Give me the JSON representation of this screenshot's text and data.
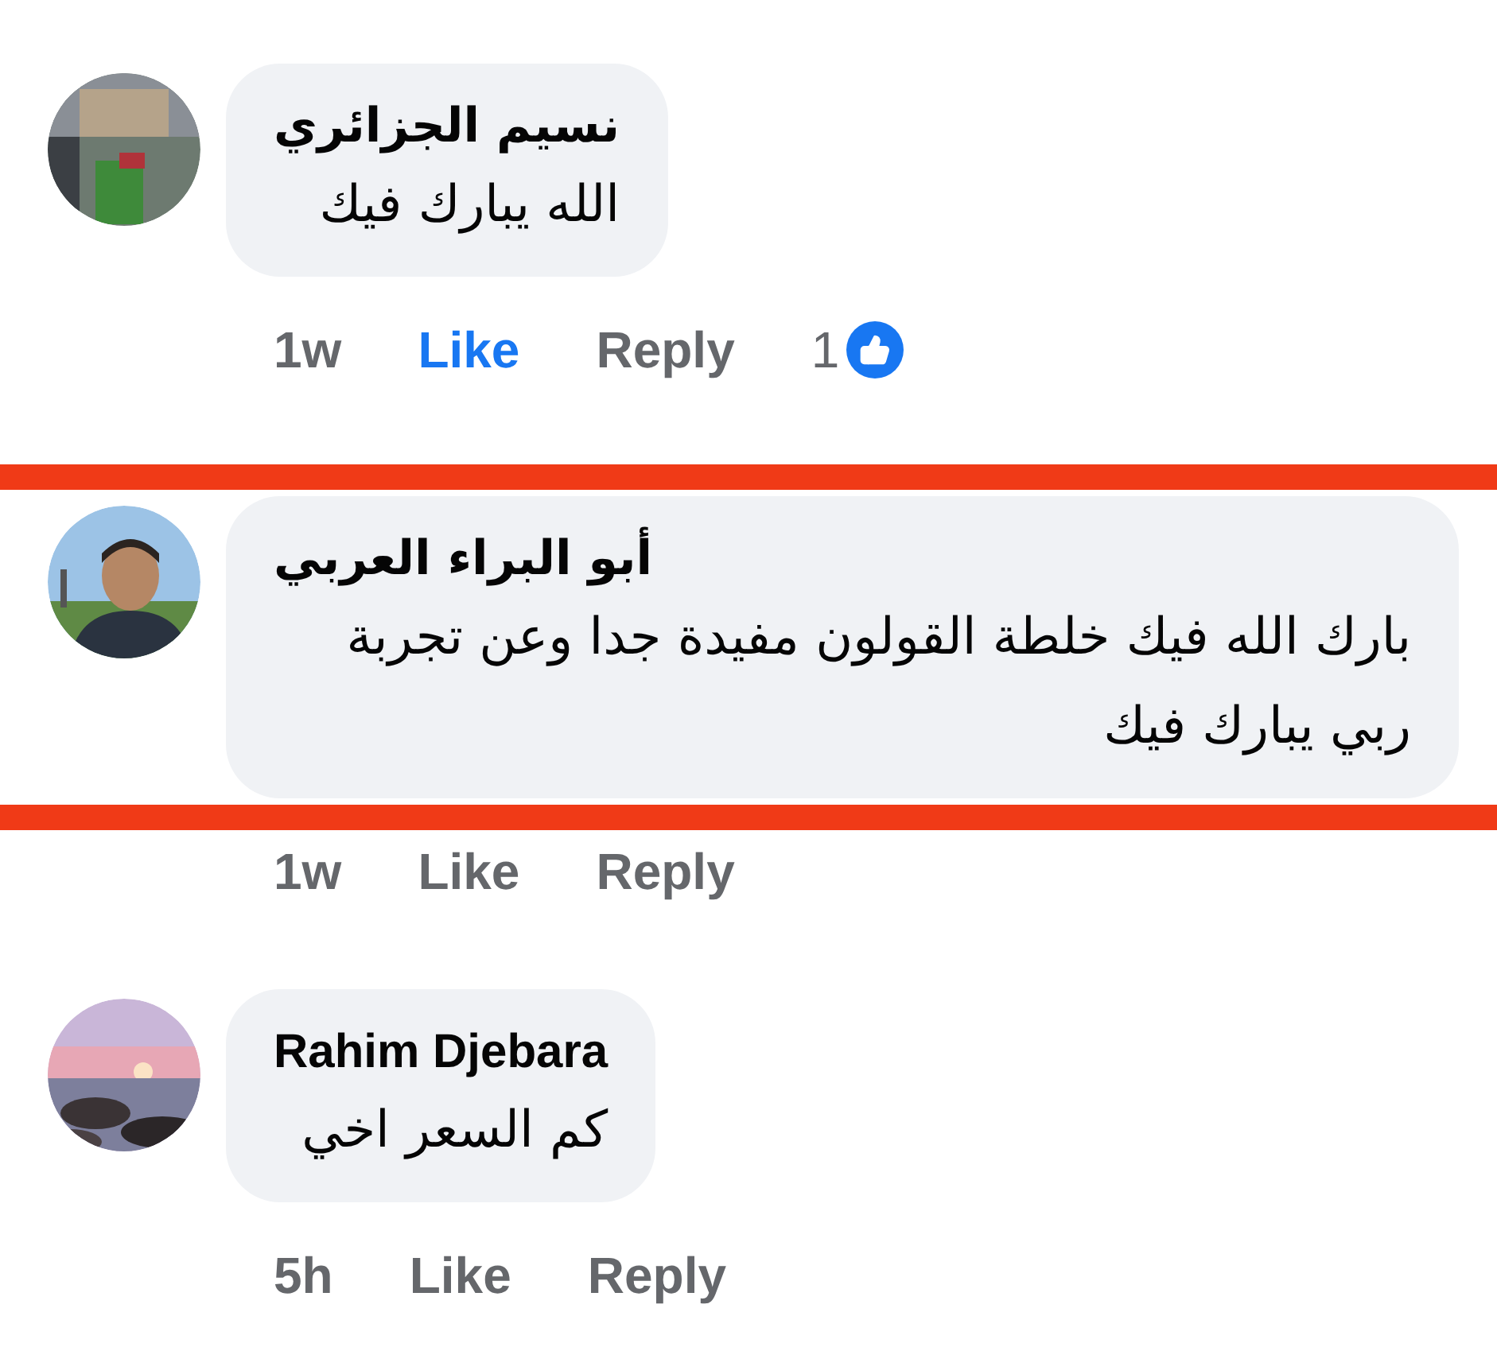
{
  "comments": [
    {
      "author": "نسيم الجزائري",
      "text": "الله يبارك فيك",
      "time": "1w",
      "like": "Like",
      "liked": true,
      "reply": "Reply",
      "reactions": "1",
      "highlighted": false
    },
    {
      "author": "أبو البراء العربي",
      "text": "بارك الله فيك خلطة القولون مفيدة جدا وعن تجربة ربي يبارك  فيك",
      "time": "1w",
      "like": "Like",
      "liked": false,
      "reply": "Reply",
      "highlighted": true
    },
    {
      "author": "Rahim Djebara",
      "text": "كم السعر اخي",
      "time": "5h",
      "like": "Like",
      "liked": false,
      "reply": "Reply",
      "highlighted": false
    }
  ]
}
